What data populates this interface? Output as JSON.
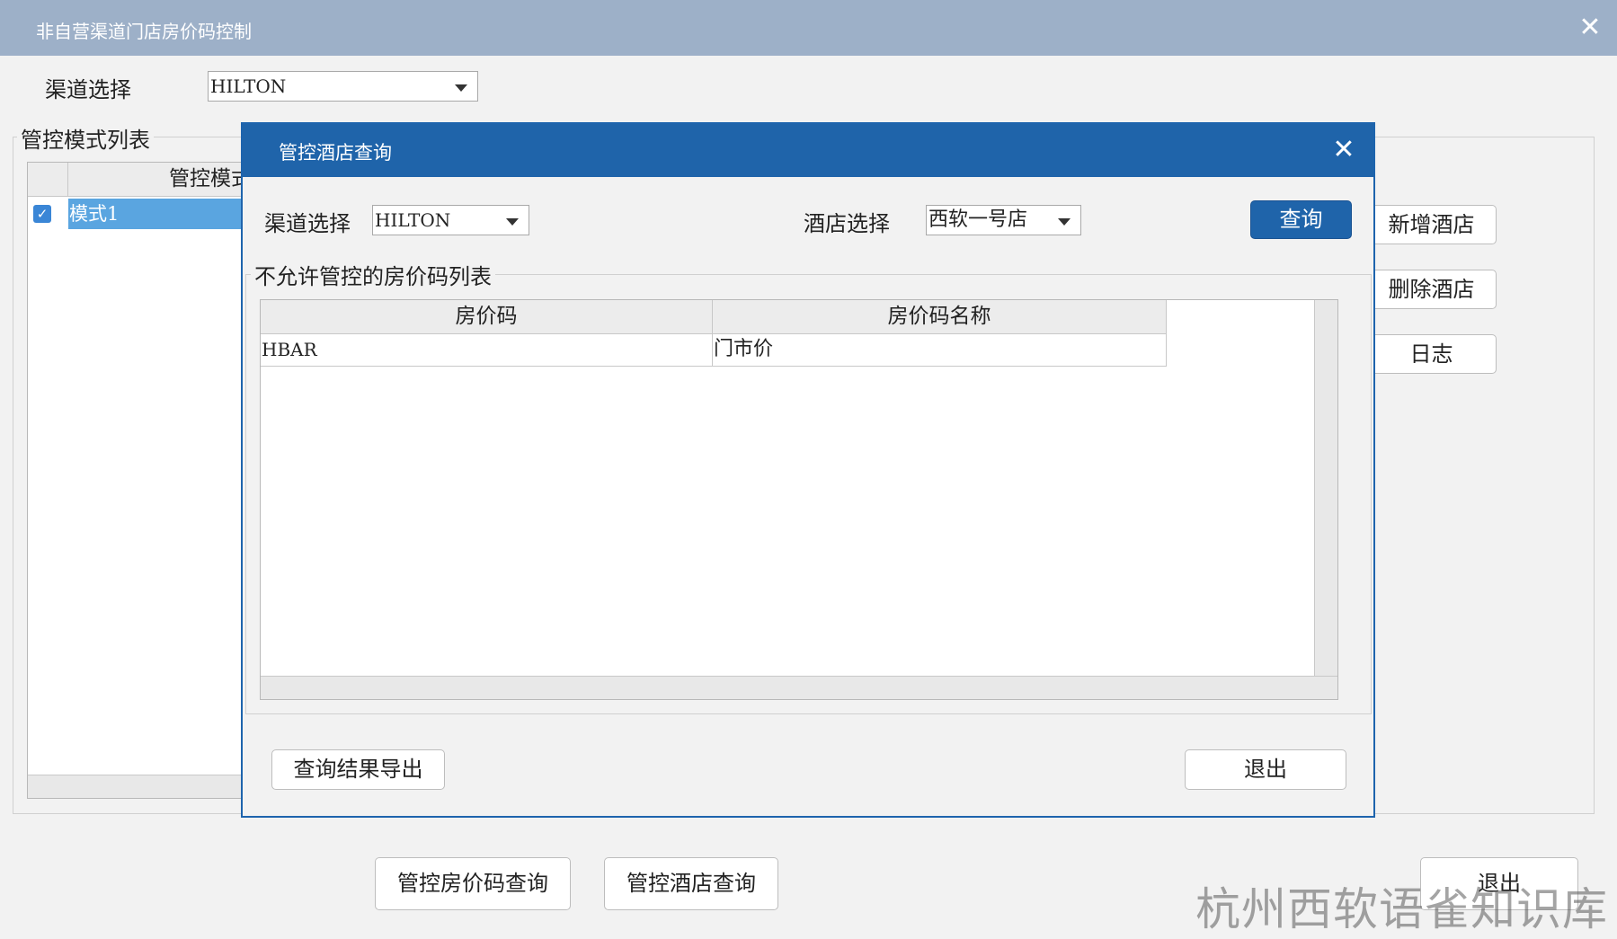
{
  "outer": {
    "title": "非自营渠道门店房价码控制",
    "close_glyph": "✕",
    "channel_label": "渠道选择",
    "channel_value": "HILTON",
    "mode_list_title": "管控模式列表",
    "mode_grid_header": "管控模式",
    "mode_rows": [
      {
        "checked": true,
        "name": "模式1"
      }
    ],
    "side_buttons": {
      "add_hotel": "新增酒店",
      "delete_hotel": "删除酒店",
      "log": "日志"
    },
    "bottom_buttons": {
      "rate_code_query": "管控房价码查询",
      "hotel_query": "管控酒店查询",
      "exit": "退出"
    }
  },
  "dialog": {
    "title": "管控酒店查询",
    "close_glyph": "✕",
    "channel_label": "渠道选择",
    "channel_value": "HILTON",
    "hotel_label": "酒店选择",
    "hotel_value": "西软一号店",
    "query_button": "查询",
    "list_title": "不允许管控的房价码列表",
    "columns": [
      "房价码",
      "房价码名称"
    ],
    "rows": [
      [
        "HBAR",
        "门市价"
      ]
    ],
    "export_button": "查询结果导出",
    "exit_button": "退出"
  },
  "watermark": "杭州西软语雀知识库",
  "colors": {
    "outer_titlebar": "#9db0c8",
    "dialog_titlebar": "#1f64aa",
    "selected_row": "#5aa5e0",
    "primary_button": "#1f64aa"
  }
}
